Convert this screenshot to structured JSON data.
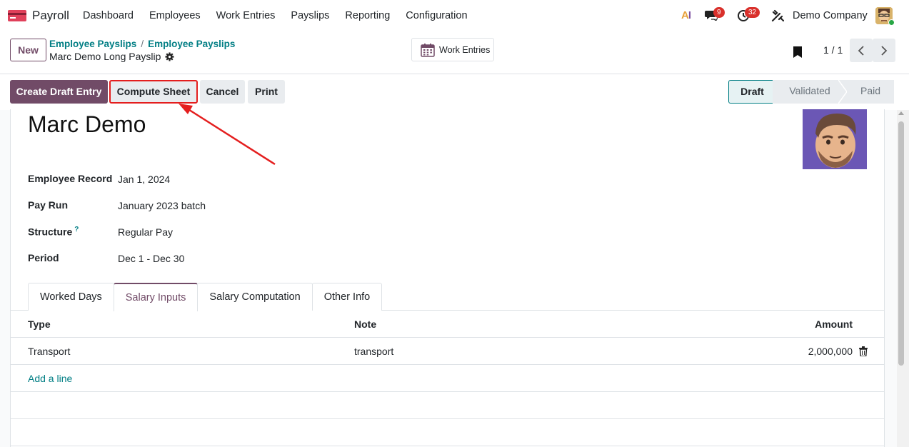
{
  "navbar": {
    "app_name": "Payroll",
    "menu": [
      "Dashboard",
      "Employees",
      "Work Entries",
      "Payslips",
      "Reporting",
      "Configuration"
    ],
    "ai_label_a": "A",
    "ai_label_i": "I",
    "chat_count": "9",
    "activity_count": "32",
    "company": "Demo Company"
  },
  "control": {
    "new_label": "New",
    "breadcrumb": [
      "Employee Payslips",
      "Employee Payslips"
    ],
    "breadcrumb_sep": "/",
    "record_title": "Marc Demo Long Payslip",
    "work_entries_label": "Work Entries",
    "pager": "1 / 1"
  },
  "actions": {
    "create_draft": "Create Draft Entry",
    "compute_sheet": "Compute Sheet",
    "cancel": "Cancel",
    "print": "Print"
  },
  "status": {
    "steps": [
      "Draft",
      "Validated",
      "Paid"
    ],
    "current": "Draft"
  },
  "form": {
    "employee_name": "Marc Demo",
    "fields": [
      {
        "label": "Employee Record",
        "value": "Jan 1, 2024"
      },
      {
        "label": "Pay Run",
        "value": "January 2023 batch"
      },
      {
        "label": "Structure",
        "value": "Regular Pay",
        "help": "?"
      },
      {
        "label": "Period",
        "value": "Dec 1 - Dec 30"
      }
    ]
  },
  "tabs": [
    {
      "label": "Worked Days",
      "active": false
    },
    {
      "label": "Salary Inputs",
      "active": true
    },
    {
      "label": "Salary Computation",
      "active": false
    },
    {
      "label": "Other Info",
      "active": false
    }
  ],
  "table": {
    "headers": {
      "type": "Type",
      "note": "Note",
      "amount": "Amount"
    },
    "rows": [
      {
        "type": "Transport",
        "note": "transport",
        "amount": "2,000,000"
      }
    ],
    "add_line": "Add a line"
  },
  "colors": {
    "brand": "#714b67",
    "link": "#017e84",
    "highlight": "#e41e1e"
  }
}
